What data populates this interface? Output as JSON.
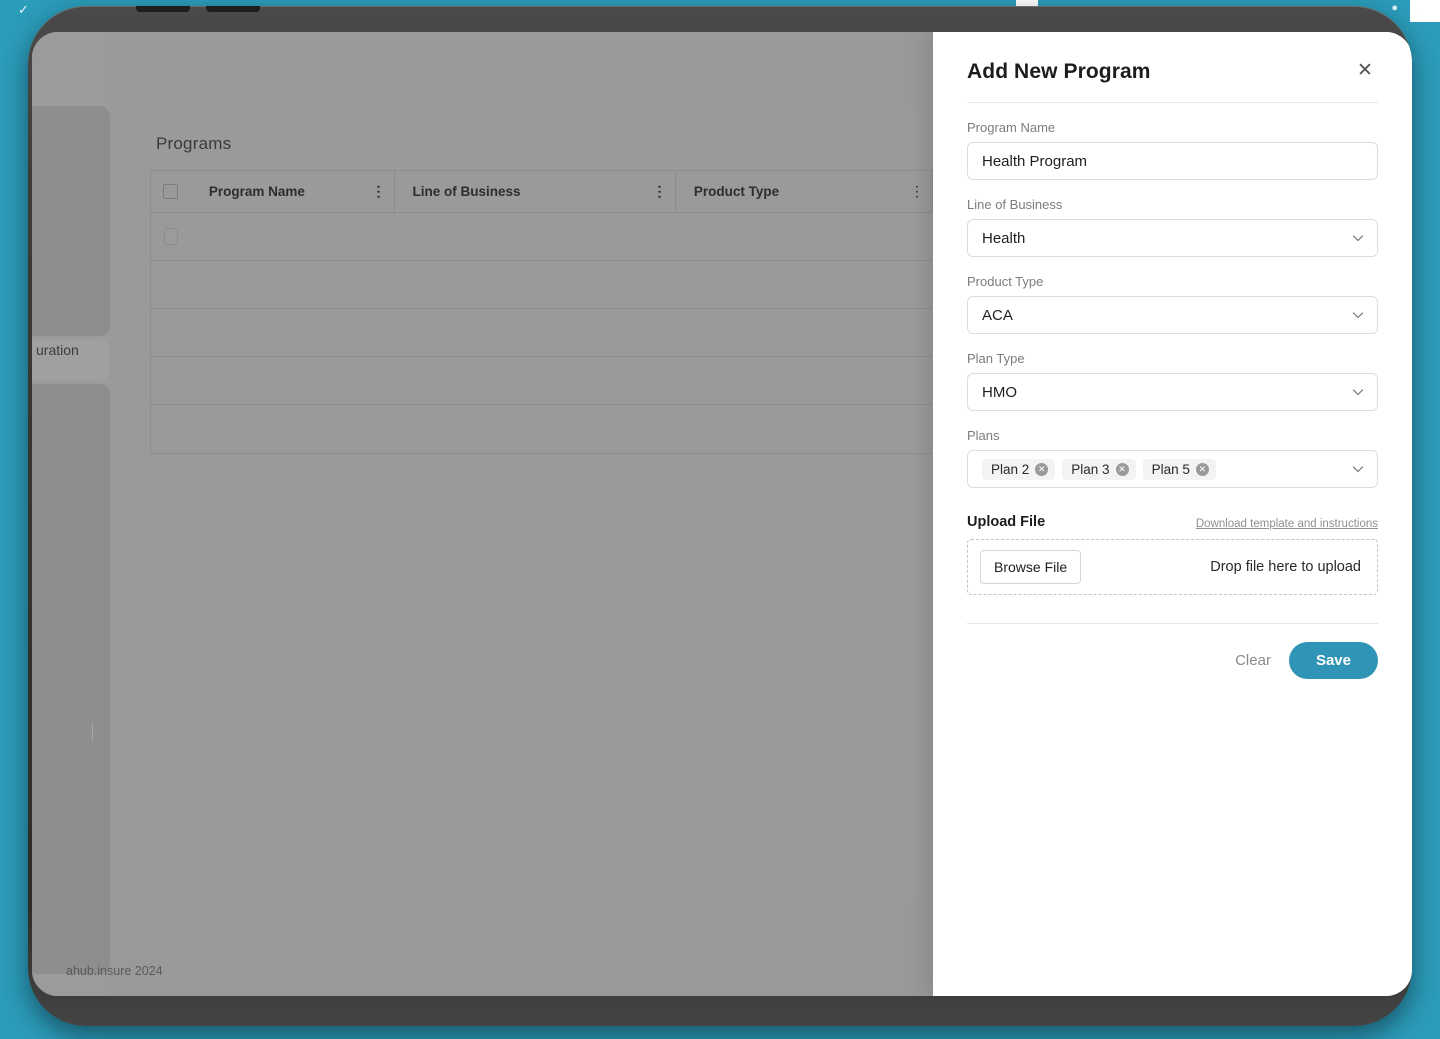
{
  "theme": {
    "brand_teal": "#2b9cba",
    "save_button": "#2f94b5",
    "drawer_bg": "#ffffff",
    "dim_overlay": "#949494"
  },
  "app": {
    "sidebar": {
      "visible_label": "uration"
    },
    "panel": {
      "title": "Programs",
      "table": {
        "columns": [
          {
            "label": "Program Name"
          },
          {
            "label": "Line of Business"
          },
          {
            "label": "Product Type"
          },
          {
            "label": ""
          }
        ],
        "rows": [
          {
            "cells": [
              "",
              "",
              "",
              ""
            ]
          },
          {
            "cells": [
              "",
              "",
              "",
              ""
            ]
          },
          {
            "cells": [
              "",
              "",
              "",
              ""
            ]
          },
          {
            "cells": [
              "",
              "",
              "",
              ""
            ]
          },
          {
            "cells": [
              "",
              "",
              "",
              ""
            ]
          }
        ]
      }
    },
    "footer": {
      "copyright": "ahub.insure 2024"
    }
  },
  "drawer": {
    "title": "Add New Program",
    "close_label": "✕",
    "fields": {
      "program_name": {
        "label": "Program Name",
        "value": "Health Program",
        "placeholder": "Program Name"
      },
      "line_of_business": {
        "label": "Line of Business",
        "value": "Health"
      },
      "product_type": {
        "label": "Product Type",
        "value": "ACA"
      },
      "plan_type": {
        "label": "Plan Type",
        "value": "HMO"
      },
      "plans": {
        "label": "Plans",
        "chips": [
          {
            "label": "Plan 2",
            "remove": "✕"
          },
          {
            "label": "Plan 3",
            "remove": "✕"
          },
          {
            "label": "Plan 5",
            "remove": "✕"
          }
        ]
      }
    },
    "upload": {
      "title": "Upload File",
      "template_link": "Download template and instructions",
      "browse_label": "Browse File",
      "drop_text": "Drop file here to upload"
    },
    "actions": {
      "clear_label": "Clear",
      "save_label": "Save"
    }
  }
}
